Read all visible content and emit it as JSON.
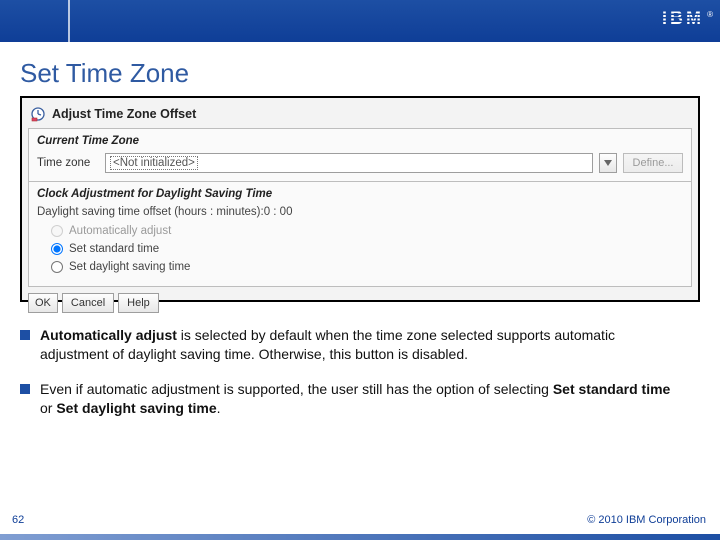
{
  "brand": {
    "logo_text": "IBM",
    "registered": "®"
  },
  "slide": {
    "title": "Set Time Zone",
    "page_number": "62",
    "copyright": "© 2010 IBM Corporation"
  },
  "dialog": {
    "title": "Adjust Time Zone Offset",
    "section1_title": "Current Time Zone",
    "timezone_label": "Time zone",
    "timezone_value": "<Not initialized>",
    "define_button": "Define...",
    "section2_title": "Clock Adjustment for Daylight Saving Time",
    "dst_offset_label": "Daylight saving time offset (hours : minutes):",
    "dst_offset_value": "0 : 00",
    "radios": {
      "auto": "Automatically adjust",
      "standard": "Set standard time",
      "daylight": "Set daylight saving time",
      "selected": "standard"
    },
    "buttons": {
      "ok": "OK",
      "cancel": "Cancel",
      "help": "Help"
    }
  },
  "bullets": [
    {
      "before_bold": "",
      "bold": "Automatically adjust",
      "after_bold": " is selected by default when the time zone selected supports automatic adjustment of daylight saving time. Otherwise, this button is disabled."
    },
    {
      "text_before": "Even if automatic adjustment is supported, the user still has the option of selecting ",
      "bold1": "Set standard time",
      "mid": " or ",
      "bold2": "Set daylight saving time",
      "end": "."
    }
  ]
}
